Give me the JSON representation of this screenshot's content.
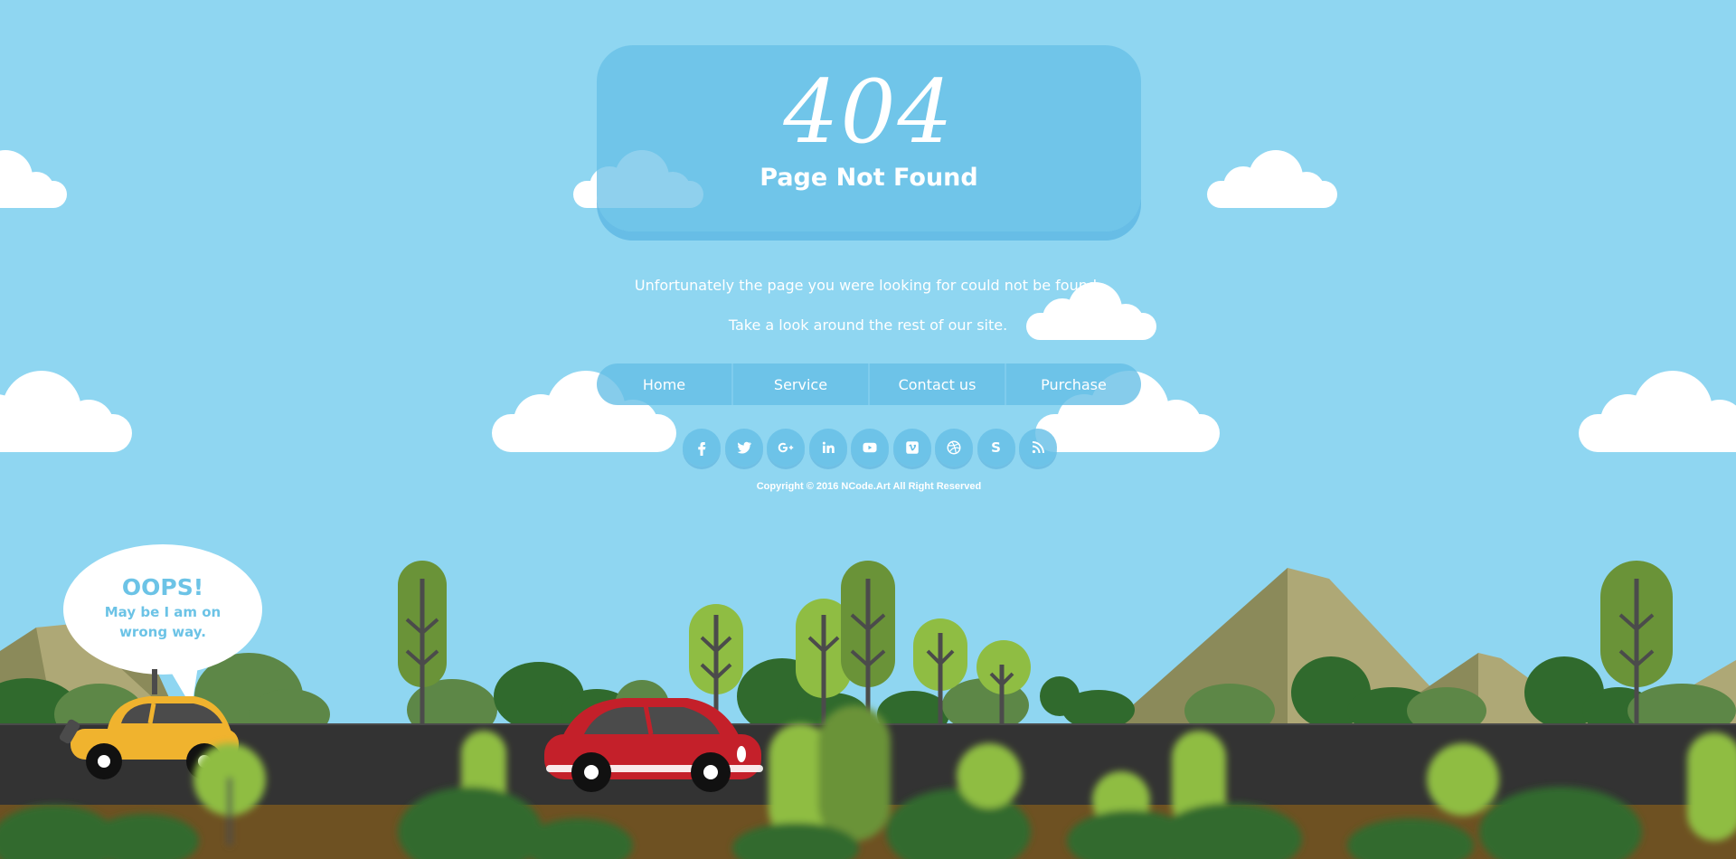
{
  "error": {
    "code": "404",
    "title": "Page Not Found"
  },
  "message": {
    "line1": "Unfortunately the page you were looking for could not be found.",
    "line2": "Take a look around the rest of our site."
  },
  "nav": {
    "items": [
      {
        "label": "Home"
      },
      {
        "label": "Service"
      },
      {
        "label": "Contact us"
      },
      {
        "label": "Purchase"
      }
    ]
  },
  "social": {
    "icons": [
      "facebook-icon",
      "twitter-icon",
      "google-plus-icon",
      "linkedin-icon",
      "youtube-icon",
      "vimeo-icon",
      "dribbble-icon",
      "skype-icon",
      "rss-icon"
    ]
  },
  "footer": {
    "copyright": "Copyright © 2016 NCode.Art All Right Reserved"
  },
  "bubble": {
    "title": "OOPS!",
    "line1": "May be I am on",
    "line2": "wrong way."
  },
  "colors": {
    "sky": "#8fd6f1",
    "panel": "#64bee6",
    "road": "#333333",
    "dirt": "#6e5122",
    "tree_dark": "#306a2d",
    "tree_light": "#8fbd43",
    "car_red": "#c4202a",
    "car_yellow": "#f0b32e",
    "bubble_text": "#6cc3e6"
  }
}
